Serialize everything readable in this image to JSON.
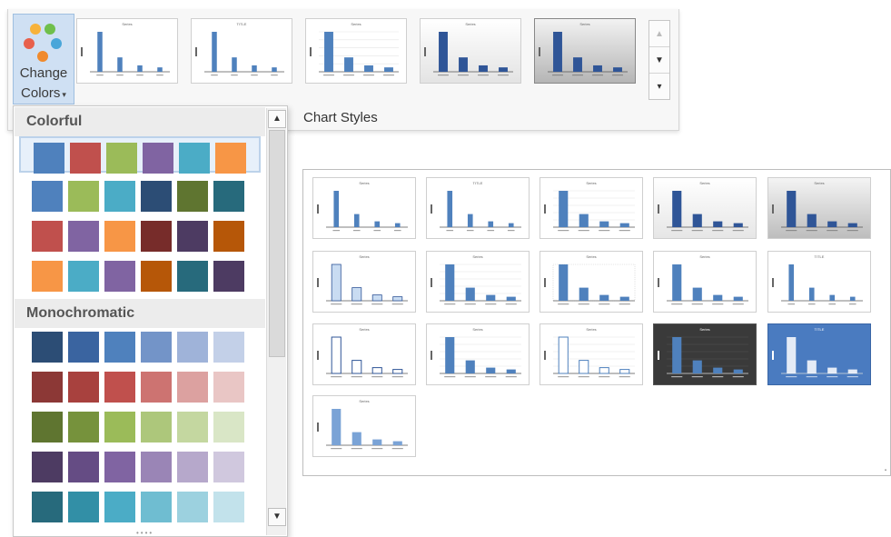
{
  "change_colors": {
    "label_line1": "Change",
    "label_line2": "Colors"
  },
  "ribbon": {
    "chart_styles_label": "Chart Styles"
  },
  "dropdown": {
    "sections": [
      {
        "heading": "Colorful",
        "rows": [
          [
            "#4f81bd",
            "#c0504d",
            "#9bbb59",
            "#8064a2",
            "#4bacc6",
            "#f79646"
          ],
          [
            "#4f81bd",
            "#9bbb59",
            "#4bacc6",
            "#2c4d75",
            "#5f7530",
            "#276a7c"
          ],
          [
            "#c0504d",
            "#8064a2",
            "#f79646",
            "#772c2a",
            "#4d3b62",
            "#b65708"
          ],
          [
            "#f79646",
            "#4bacc6",
            "#8064a2",
            "#b65708",
            "#276a7c",
            "#4d3b62"
          ]
        ]
      },
      {
        "heading": "Monochromatic",
        "rows": [
          [
            "#2c4d75",
            "#3a64a0",
            "#4f81bd",
            "#7394c8",
            "#9fb3d9",
            "#c3d0e8"
          ],
          [
            "#8c3836",
            "#a8413e",
            "#c0504d",
            "#cd7371",
            "#dca1a0",
            "#e9c6c5"
          ],
          [
            "#5f7530",
            "#76923c",
            "#9bbb59",
            "#adc77b",
            "#c4d7a0",
            "#d9e6c6"
          ],
          [
            "#4d3b62",
            "#654c84",
            "#8064a2",
            "#9a85b6",
            "#b6a8cb",
            "#d0c8de"
          ],
          [
            "#276a7c",
            "#328fa6",
            "#4bacc6",
            "#6fbdd1",
            "#9cd1df",
            "#c2e2eb"
          ]
        ]
      }
    ]
  },
  "thumb_labels": {
    "title": "Series",
    "title_alt": "TITLE"
  },
  "gallery_styles": [
    "s1",
    "s2",
    "s3",
    "s4",
    "s5"
  ],
  "panel_styles": [
    "s1",
    "s2",
    "s3",
    "s4",
    "s5",
    "s6",
    "s7",
    "s8",
    "s9",
    "s10",
    "s11",
    "s12",
    "s13",
    "s14",
    "s15",
    "s16"
  ],
  "colors": {
    "accent": "#4f81bd",
    "dark_bar": "#2f5597"
  }
}
